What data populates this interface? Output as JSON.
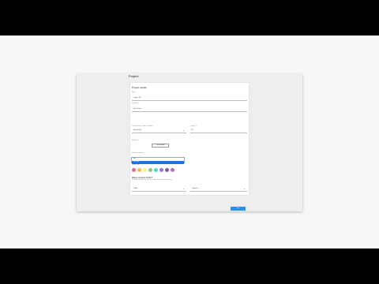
{
  "window": {
    "title": "Project"
  },
  "form": {
    "title": "Project details",
    "name": {
      "label": "Name",
      "value": "Project 34"
    },
    "description": {
      "label": "Description",
      "value": "Test Project"
    },
    "owner": {
      "label": "Owner (Optional, Visible to members)",
      "value": "Jhon Smith"
    },
    "priority": {
      "label": "Priority (%)",
      "value": "50"
    },
    "attachment": {
      "label": "Attachment",
      "button_label": "Pick a file/image"
    },
    "members": {
      "label": "Add project members",
      "items": [
        "Alex",
        "Jhon Smith"
      ],
      "selected_index": 1
    },
    "color": {
      "label": "Project Color",
      "swatches": [
        "#f06292",
        "#ffb74d",
        "#fff176",
        "#81c784",
        "#4dd0e1",
        "#9575cd",
        "#7e57c2",
        "#ba68c8"
      ]
    },
    "public": {
      "title": "Make a project Public?",
      "subtitle": "This will make the project visible to all users outside of the team and this project settings",
      "left_value": "Public",
      "right_value": "Optional"
    }
  },
  "actions": {
    "submit_label": "Save"
  }
}
